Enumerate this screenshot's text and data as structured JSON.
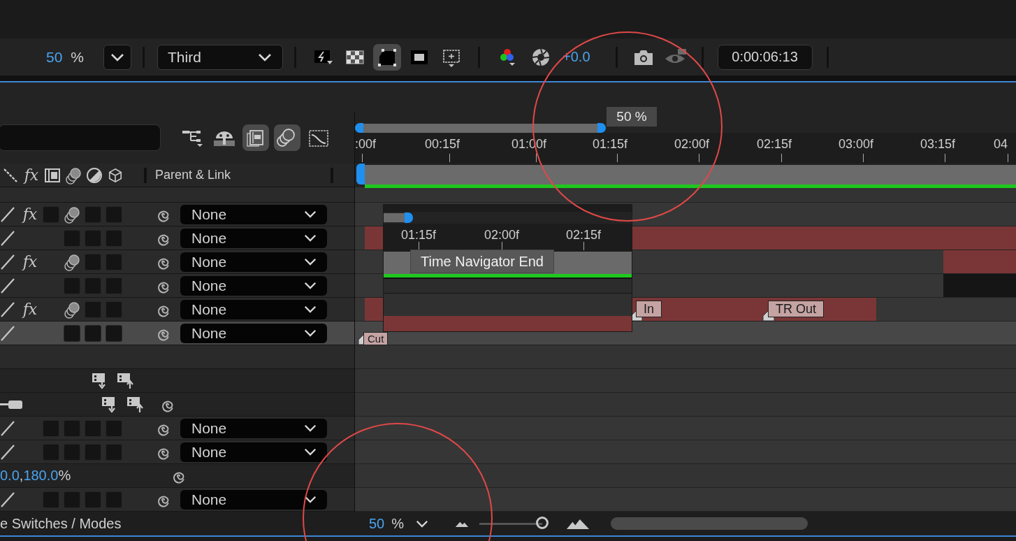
{
  "viewer_toolbar": {
    "zoom_value": "50",
    "zoom_unit": "%",
    "resolution": "Third",
    "exposure": "+0.0",
    "timecode": "0:00:06:13",
    "view_buttons": [
      {
        "kind": "fast-preview",
        "selected": false
      },
      {
        "kind": "transparency-grid",
        "selected": false
      },
      {
        "kind": "mask-path",
        "selected": true
      },
      {
        "kind": "region-of-interest",
        "selected": false
      },
      {
        "kind": "guides",
        "selected": false
      }
    ]
  },
  "timeline": {
    "toolbar_buttons": [
      {
        "kind": "flowchart",
        "selected": false
      },
      {
        "kind": "shy",
        "selected": false
      },
      {
        "kind": "frame-blend",
        "selected": true
      },
      {
        "kind": "motion-blur",
        "selected": true
      },
      {
        "kind": "graph-editor",
        "selected": false
      }
    ],
    "zoom_tooltip": "50 %",
    "ruler": [
      ":00f",
      "00:15f",
      "01:00f",
      "01:15f",
      "02:00f",
      "02:15f",
      "03:00f",
      "03:15f",
      "04"
    ],
    "column_header": {
      "switches": [
        {
          "kind": "shy-line"
        },
        {
          "kind": "label",
          "text": "fx"
        },
        {
          "kind": "frame-blend"
        },
        {
          "kind": "motion-blur"
        },
        {
          "kind": "adjustment"
        },
        {
          "kind": "cube"
        }
      ],
      "parent_label": "Parent & Link"
    },
    "rows": [
      {
        "kind": "layer",
        "selected": false,
        "switches": [
          {
            "kind": "label",
            "text": "fx"
          },
          {
            "kind": "box"
          },
          {
            "kind": "motion-blur"
          },
          {
            "kind": "box"
          },
          {
            "kind": "box"
          }
        ],
        "parent": "None",
        "markers": []
      },
      {
        "kind": "layer",
        "selected": false,
        "switches": [
          {
            "kind": "empty"
          },
          {
            "kind": "empty"
          },
          {
            "kind": "box"
          },
          {
            "kind": "box"
          },
          {
            "kind": "box"
          }
        ],
        "parent": "None",
        "clip": {
          "kind": "red"
        },
        "markers": []
      },
      {
        "kind": "layer",
        "selected": false,
        "switches": [
          {
            "kind": "label",
            "text": "fx"
          },
          {
            "kind": "empty"
          },
          {
            "kind": "motion-blur"
          },
          {
            "kind": "box"
          },
          {
            "kind": "box"
          }
        ],
        "parent": "None",
        "clip": {
          "kind": "red"
        },
        "markers": []
      },
      {
        "kind": "layer",
        "selected": false,
        "switches": [
          {
            "kind": "empty"
          },
          {
            "kind": "empty"
          },
          {
            "kind": "box"
          },
          {
            "kind": "box"
          },
          {
            "kind": "box"
          }
        ],
        "parent": "None",
        "clip": {
          "kind": "dark"
        },
        "markers": []
      },
      {
        "kind": "layer",
        "selected": false,
        "switches": [
          {
            "kind": "label",
            "text": "fx"
          },
          {
            "kind": "empty"
          },
          {
            "kind": "motion-blur"
          },
          {
            "kind": "box"
          },
          {
            "kind": "box"
          }
        ],
        "parent": "None",
        "clip": {
          "kind": "red"
        },
        "markers": [
          {
            "text": "In"
          },
          {
            "text": "TR Out"
          }
        ]
      },
      {
        "kind": "layer",
        "selected": true,
        "switches": [
          {
            "kind": "empty"
          },
          {
            "kind": "empty"
          },
          {
            "kind": "box"
          },
          {
            "kind": "box"
          },
          {
            "kind": "box"
          }
        ],
        "parent": "None",
        "markers": [
          {
            "text": "Cut"
          }
        ]
      },
      {
        "kind": "blank"
      },
      {
        "kind": "keyframe-tools"
      },
      {
        "kind": "effect-tools"
      },
      {
        "kind": "layer",
        "selected": false,
        "switches": [
          {
            "kind": "empty"
          },
          {
            "kind": "box"
          },
          {
            "kind": "box"
          },
          {
            "kind": "box"
          },
          {
            "kind": "box"
          }
        ],
        "parent": "None",
        "markers": []
      },
      {
        "kind": "layer",
        "selected": false,
        "switches": [
          {
            "kind": "empty"
          },
          {
            "kind": "box"
          },
          {
            "kind": "box"
          },
          {
            "kind": "box"
          },
          {
            "kind": "box"
          }
        ],
        "parent": "None",
        "markers": []
      },
      {
        "kind": "value",
        "parts": [
          {
            "kind": "number",
            "text": "0.0"
          },
          {
            "kind": "plain",
            "text": ","
          },
          {
            "kind": "number",
            "text": "180.0"
          },
          {
            "kind": "plain",
            "text": "%"
          }
        ]
      },
      {
        "kind": "layer",
        "selected": false,
        "switches": [
          {
            "kind": "empty"
          },
          {
            "kind": "box"
          },
          {
            "kind": "box"
          },
          {
            "kind": "box"
          },
          {
            "kind": "box"
          }
        ],
        "parent": "None",
        "markers": []
      }
    ],
    "navigator_popup": {
      "ruler": [
        "01:15f",
        "02:00f",
        "02:15f"
      ],
      "tooltip": "Time Navigator End"
    }
  },
  "status_bar": {
    "toggle_label": "e Switches / Modes",
    "zoom_value": "50",
    "zoom_unit": "%",
    "zoom_slider": {
      "level": 1
    }
  }
}
